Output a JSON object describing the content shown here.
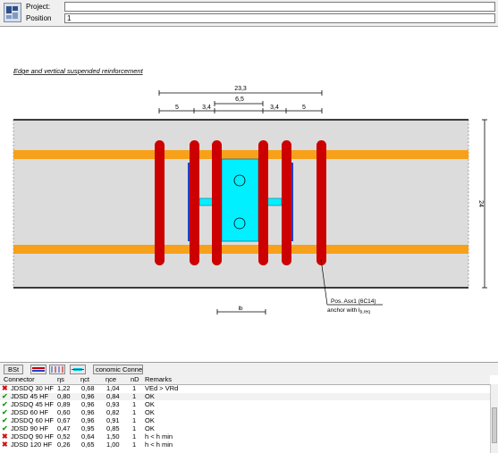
{
  "header": {
    "project_label": "Project:",
    "project_value": "",
    "position_label": "Position",
    "position_value": "1"
  },
  "drawing": {
    "title": "Edge and vertical suspended reinforcement",
    "dim_total": "23,3",
    "dim_inner": "6,5",
    "dim_5_left": "5",
    "dim_34_left": "3,4",
    "dim_34_right": "3,4",
    "dim_5_right": "5",
    "dim_height": "24",
    "pos_label": "Pos. Asx1 (6C14)",
    "anchor_label": "anchor with l",
    "anchor_sub": "b,req",
    "lb_label": "lb",
    "colors": {
      "slab_fill": "#dcdcdc",
      "orange_rebar": "#f7a11a",
      "red_stirrup": "#cc0000",
      "blue_plate": "#2244cc",
      "cyan_connector": "#00f0ff"
    }
  },
  "tabs": {
    "bst": "BSt",
    "economic": "conomic Connect"
  },
  "table": {
    "columns": [
      "Connector",
      "ηs",
      "ηct",
      "ηce",
      "nD",
      "Remarks"
    ],
    "rows": [
      {
        "status": "fail",
        "name": "JDSDQ 30 HF",
        "eta_s": "1,22",
        "eta_ct": "0,68",
        "eta_ce": "1,04",
        "nD": "1",
        "remarks": "VEd > VRd"
      },
      {
        "status": "ok",
        "name": "JDSD 45 HF",
        "eta_s": "0,80",
        "eta_ct": "0,96",
        "eta_ce": "0,84",
        "nD": "1",
        "remarks": "OK"
      },
      {
        "status": "ok",
        "name": "JDSDQ 45 HF",
        "eta_s": "0,89",
        "eta_ct": "0,96",
        "eta_ce": "0,93",
        "nD": "1",
        "remarks": "OK"
      },
      {
        "status": "ok",
        "name": "JDSD 60 HF",
        "eta_s": "0,60",
        "eta_ct": "0,96",
        "eta_ce": "0,82",
        "nD": "1",
        "remarks": "OK"
      },
      {
        "status": "ok",
        "name": "JDSDQ 60 HF",
        "eta_s": "0,67",
        "eta_ct": "0,96",
        "eta_ce": "0,91",
        "nD": "1",
        "remarks": "OK"
      },
      {
        "status": "ok",
        "name": "JDSD 90 HF",
        "eta_s": "0,47",
        "eta_ct": "0,95",
        "eta_ce": "0,85",
        "nD": "1",
        "remarks": "OK"
      },
      {
        "status": "fail",
        "name": "JDSDQ 90 HF",
        "eta_s": "0,52",
        "eta_ct": "0,64",
        "eta_ce": "1,50",
        "nD": "1",
        "remarks": "h < h min"
      },
      {
        "status": "fail",
        "name": "JDSD 120 HF",
        "eta_s": "0,26",
        "eta_ct": "0,65",
        "eta_ce": "1,00",
        "nD": "1",
        "remarks": "h < h min"
      }
    ]
  }
}
